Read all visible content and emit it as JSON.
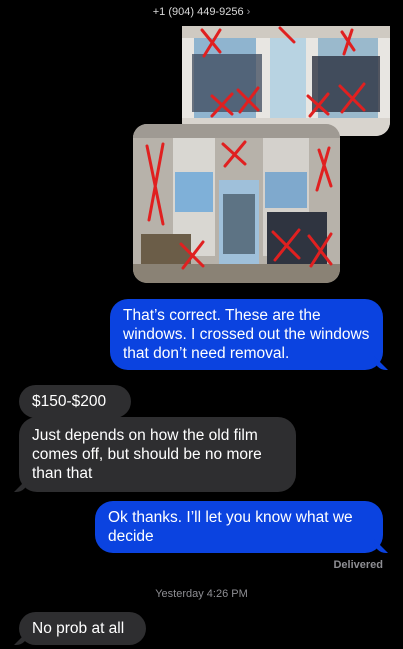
{
  "header": {
    "contact": "+1 (904) 449-9256",
    "chevron": "›"
  },
  "photos": [
    {
      "name": "store-front-windows-photo-1"
    },
    {
      "name": "store-front-windows-photo-2"
    }
  ],
  "messages": [
    {
      "from": "me",
      "text": "That’s correct. These are the windows. I crossed out the windows that don’t need removal."
    },
    {
      "from": "them",
      "text": "$150-$200"
    },
    {
      "from": "them",
      "text": "Just depends on how the old film comes off, but should be no more than that"
    },
    {
      "from": "me",
      "text": "Ok thanks. I’ll let you know what we decide"
    },
    {
      "from": "them",
      "text": "No prob at all"
    }
  ],
  "status": {
    "delivered": "Delivered",
    "timestamp": "Yesterday 4:26 PM"
  },
  "colors": {
    "sent_bubble": "#0b43e0",
    "received_bubble": "#2e2e30",
    "background": "#000000",
    "markup_x": "#e02020"
  }
}
